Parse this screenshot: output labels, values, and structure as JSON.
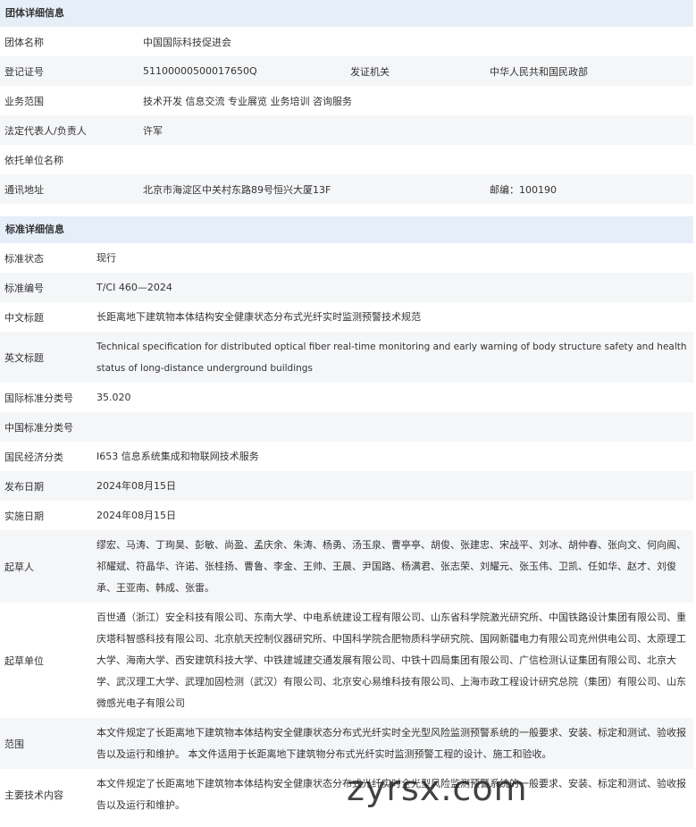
{
  "org": {
    "title": "团体详细信息",
    "name_label": "团体名称",
    "name_value": "中国国际科技促进会",
    "reg_label": "登记证号",
    "reg_value": "51100000500017650Q",
    "issuer_label": "发证机关",
    "issuer_value": "中华人民共和国民政部",
    "scope_label": "业务范围",
    "scope_value": "技术开发 信息交流 专业展览 业务培训 咨询服务",
    "rep_label": "法定代表人/负责人",
    "rep_value": "许军",
    "support_label": "依托单位名称",
    "support_value": "",
    "addr_label": "通讯地址",
    "addr_value": "北京市海淀区中关村东路89号恒兴大厦13F",
    "zip_value": "邮编：100190"
  },
  "std": {
    "title": "标准详细信息",
    "rows": [
      {
        "label": "标准状态",
        "value": "现行"
      },
      {
        "label": "标准编号",
        "value": "T/CI 460—2024"
      },
      {
        "label": "中文标题",
        "value": "长距离地下建筑物本体结构安全健康状态分布式光纤实时监测预警技术规范"
      },
      {
        "label": "英文标题",
        "value": "Technical specification for distributed optical fiber real-time monitoring and early warning of body structure safety and health status of long-distance underground buildings"
      },
      {
        "label": "国际标准分类号",
        "value": "35.020"
      },
      {
        "label": "中国标准分类号",
        "value": ""
      },
      {
        "label": "国民经济分类",
        "value": "I653 信息系统集成和物联网技术服务"
      },
      {
        "label": "发布日期",
        "value": "2024年08月15日"
      },
      {
        "label": "实施日期",
        "value": "2024年08月15日"
      },
      {
        "label": "起草人",
        "value": "缪宏、马涛、丁珣昊、彭敏、尚盈、孟庆余、朱涛、杨勇、汤玉泉、曹亭亭、胡俊、张建忠、宋战平、刘冰、胡仲春、张向文、何向阁、祁耀斌、符晶华、许诺、张桂扬、曹鲁、李金、王帅、王晨、尹国路、杨满君、张志荣、刘耀元、张玉伟、卫凯、任如华、赵才、刘俊承、王亚南、韩成、张雷。"
      },
      {
        "label": "起草单位",
        "value": "百世通（浙江）安全科技有限公司、东南大学、中电系统建设工程有限公司、山东省科学院激光研究所、中国铁路设计集团有限公司、重庆塔科智感科技有限公司、北京航天控制仪器研究所、中国科学院合肥物质科学研究院、国网新疆电力有限公司克州供电公司、太原理工大学、海南大学、西安建筑科技大学、中铁建城建交通发展有限公司、中铁十四局集团有限公司、广信检测认证集团有限公司、北京大学、武汉理工大学、武理加固检测（武汉）有限公司、北京安心易维科技有限公司、上海市政工程设计研究总院（集团）有限公司、山东微感光电子有限公司"
      },
      {
        "label": "范围",
        "value": "本文件规定了长距离地下建筑物本体结构安全健康状态分布式光纤实时全光型风险监测预警系统的一般要求、安装、标定和测试、验收报告以及运行和维护。 本文件适用于长距离地下建筑物分布式光纤实时监测预警工程的设计、施工和验收。"
      },
      {
        "label": "主要技术内容",
        "value": "本文件规定了长距离地下建筑物本体结构安全健康状态分布式光纤实时全光型风险监测预警系统的一般要求、安装、标定和测试、验收报告以及运行和维护。"
      }
    ]
  },
  "watermark": "zyrsx.com"
}
